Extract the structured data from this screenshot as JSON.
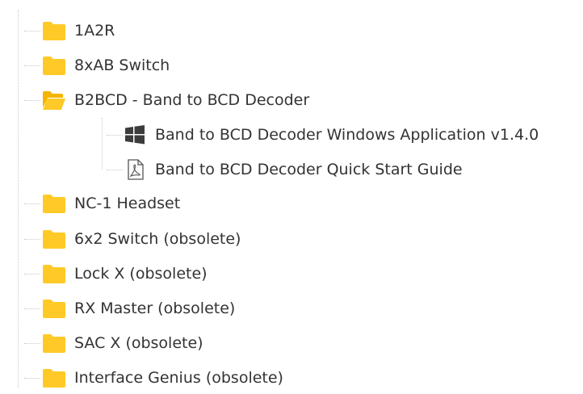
{
  "colors": {
    "folder": "#FFCA28",
    "folder_dark": "#F5B400",
    "text": "#333333",
    "guide": "#c8c8c8",
    "windows_logo": "#3c3c3c"
  },
  "tree": {
    "items": [
      {
        "label": "1A2R",
        "icon": "folder-icon"
      },
      {
        "label": "8xAB Switch",
        "icon": "folder-icon"
      },
      {
        "label": "B2BCD - Band to BCD Decoder",
        "icon": "folder-open-icon",
        "children": [
          {
            "label": "Band to BCD Decoder Windows Application v1.4.0",
            "icon": "windows-icon"
          },
          {
            "label": "Band to BCD Decoder Quick Start Guide",
            "icon": "pdf-icon"
          }
        ]
      },
      {
        "label": "NC-1 Headset",
        "icon": "folder-icon"
      },
      {
        "label": "6x2 Switch (obsolete)",
        "icon": "folder-icon"
      },
      {
        "label": "Lock X (obsolete)",
        "icon": "folder-icon"
      },
      {
        "label": "RX Master (obsolete)",
        "icon": "folder-icon"
      },
      {
        "label": "SAC X (obsolete)",
        "icon": "folder-icon"
      },
      {
        "label": "Interface Genius (obsolete)",
        "icon": "folder-icon"
      }
    ]
  }
}
